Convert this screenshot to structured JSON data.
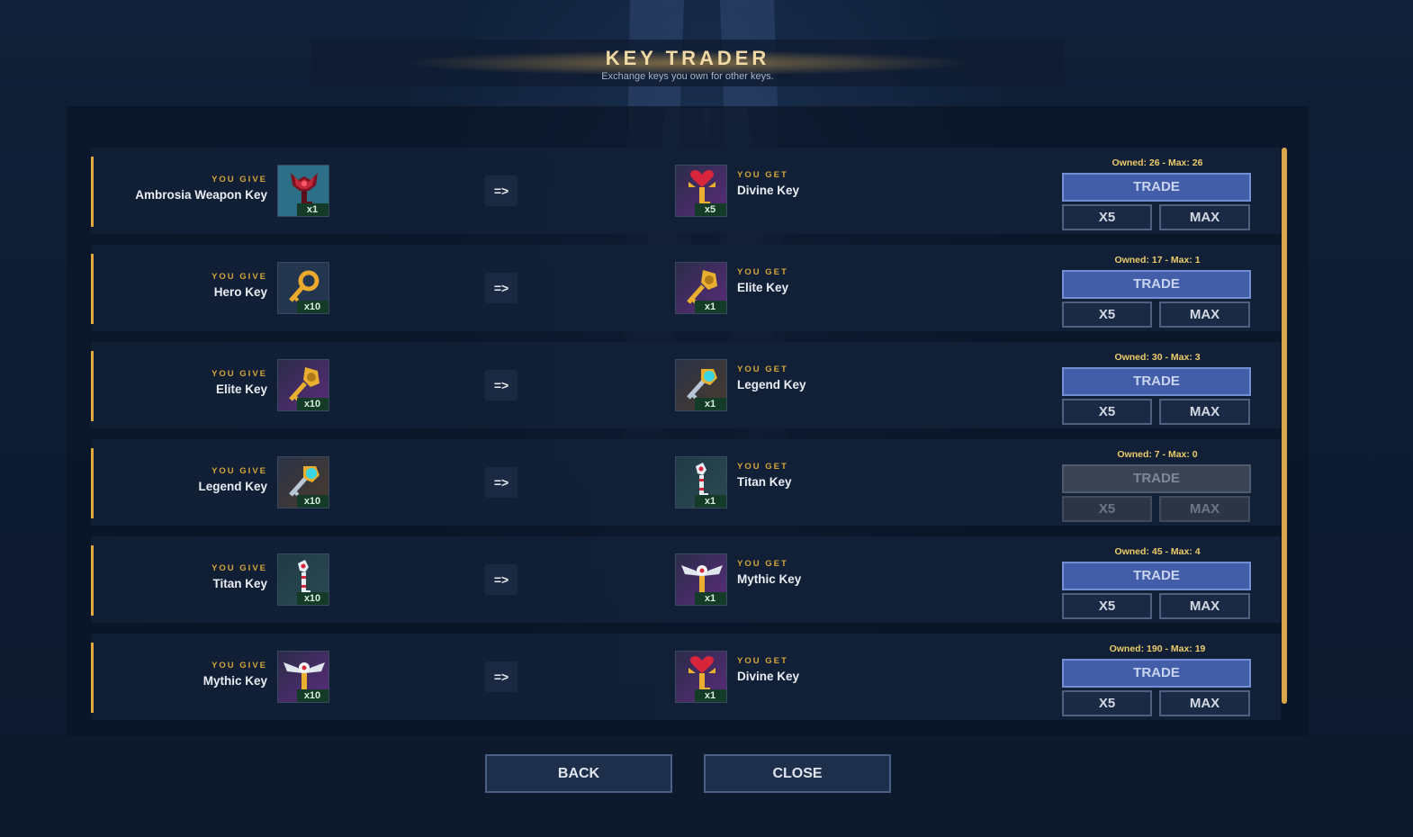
{
  "header": {
    "title": "KEY TRADER",
    "subtitle": "Exchange keys you own for other keys."
  },
  "labels": {
    "you_give": "YOU GIVE",
    "you_get": "YOU GET",
    "arrow": "=>",
    "trade": "TRADE",
    "x5": "X5",
    "max": "MAX"
  },
  "trades": [
    {
      "give": {
        "name": "Ambrosia Weapon Key",
        "qty": "x1",
        "icon": "ambrosia-weapon-key-icon"
      },
      "get": {
        "name": "Divine Key",
        "qty": "x5",
        "icon": "divine-key-icon"
      },
      "owned_text": "Owned: 26  -  Max: 26",
      "enabled": true
    },
    {
      "give": {
        "name": "Hero Key",
        "qty": "x10",
        "icon": "hero-key-icon"
      },
      "get": {
        "name": "Elite Key",
        "qty": "x1",
        "icon": "elite-key-icon"
      },
      "owned_text": "Owned: 17  -  Max: 1",
      "enabled": true
    },
    {
      "give": {
        "name": "Elite Key",
        "qty": "x10",
        "icon": "elite-key-icon"
      },
      "get": {
        "name": "Legend Key",
        "qty": "x1",
        "icon": "legend-key-icon"
      },
      "owned_text": "Owned: 30  -  Max: 3",
      "enabled": true
    },
    {
      "give": {
        "name": "Legend Key",
        "qty": "x10",
        "icon": "legend-key-icon"
      },
      "get": {
        "name": "Titan Key",
        "qty": "x1",
        "icon": "titan-key-icon"
      },
      "owned_text": "Owned: 7  -  Max: 0",
      "enabled": false
    },
    {
      "give": {
        "name": "Titan Key",
        "qty": "x10",
        "icon": "titan-key-icon"
      },
      "get": {
        "name": "Mythic Key",
        "qty": "x1",
        "icon": "mythic-key-icon"
      },
      "owned_text": "Owned: 45  -  Max: 4",
      "enabled": true
    },
    {
      "give": {
        "name": "Mythic Key",
        "qty": "x10",
        "icon": "mythic-key-icon"
      },
      "get": {
        "name": "Divine Key",
        "qty": "x1",
        "icon": "divine-key-icon"
      },
      "owned_text": "Owned: 190  -  Max: 19",
      "enabled": true
    }
  ],
  "footer": {
    "back_label": "BACK",
    "close_label": "CLOSE"
  },
  "colors": {
    "accent_gold": "#e3a93a",
    "trade_button": "#435ea8",
    "disabled_button": "#3a4454",
    "quantity_badge": "#143a28"
  }
}
